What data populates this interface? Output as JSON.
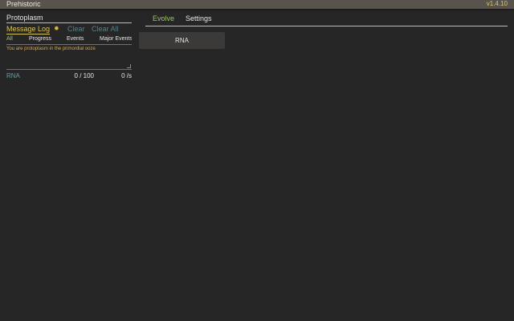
{
  "app": {
    "title": "Prehistoric",
    "version": "v1.4.10"
  },
  "sidebar": {
    "era": "Protoplasm",
    "message_log": {
      "label": "Message Log",
      "settings_icon": "gear-icon",
      "clear_label": "Clear",
      "clear_all_label": "Clear All",
      "filters": [
        "All",
        "Progress",
        "Events",
        "Major Events"
      ],
      "active_filter": "All",
      "messages": [
        "You are protoplasm in the primordial ooze"
      ]
    },
    "resources": [
      {
        "name": "RNA",
        "amount": "0 / 100",
        "rate": "0 /s"
      }
    ]
  },
  "main": {
    "tabs": [
      "Evolve",
      "Settings"
    ],
    "active_tab": "Evolve",
    "actions": [
      "RNA"
    ]
  },
  "colors": {
    "background": "#262626",
    "topbar": "#58534c",
    "accent_gold": "#d7c35a",
    "accent_green": "#9cc26a",
    "muted_teal": "#58808a",
    "message_orange": "#d7a94a"
  }
}
